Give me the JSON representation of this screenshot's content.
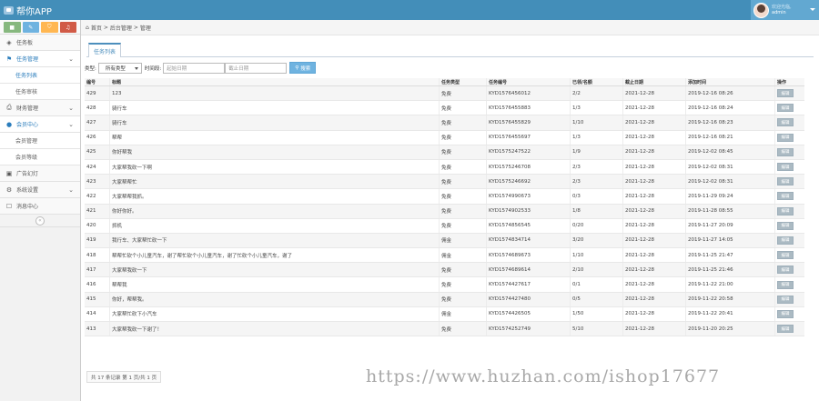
{
  "app": {
    "title": "帮你APP"
  },
  "user": {
    "greeting": "欢迎光临,",
    "name": "admin"
  },
  "quick_buttons": [
    "■",
    "✎",
    "⛉",
    "♫"
  ],
  "sidebar": {
    "items": [
      {
        "icon": "dashboard-icon",
        "glyph": "◈",
        "label": "任务板"
      },
      {
        "icon": "flag-icon",
        "glyph": "⚑",
        "label": "任务管理"
      },
      {
        "sub": true,
        "label": "任务列表"
      },
      {
        "sub": true,
        "label": "任务审核"
      },
      {
        "icon": "printer-icon",
        "glyph": "⎙",
        "label": "财务管理"
      },
      {
        "icon": "user-icon",
        "glyph": "●",
        "label": "会员中心"
      },
      {
        "sub": true,
        "label": "会员管理"
      },
      {
        "sub": true,
        "label": "会员等级"
      },
      {
        "icon": "picture-icon",
        "glyph": "▣",
        "label": "广告幻灯"
      },
      {
        "icon": "gear-icon",
        "glyph": "⚙",
        "label": "系统设置"
      },
      {
        "icon": "bookmark-icon",
        "glyph": "☐",
        "label": "消息中心"
      }
    ],
    "collapse_glyph": "«"
  },
  "breadcrumb": {
    "home": "首页",
    "level2": "后台管理",
    "current": "管理",
    "sep": ">"
  },
  "tabs": [
    {
      "label": "任务列表"
    }
  ],
  "filters": {
    "type_label": "类型:",
    "type_value": "所有类型",
    "time_label": "时间段:",
    "start_placeholder": "起始日期",
    "end_placeholder": "截止日期",
    "search_label": "搜索"
  },
  "table": {
    "headers": [
      "编号",
      "标题",
      "任务类型",
      "任务编号",
      "已领/名额",
      "截止日期",
      "添加时间",
      "操作"
    ],
    "action_label": "编辑",
    "rows": [
      [
        "429",
        "123",
        "免费",
        "KYD1576456012",
        "2/2",
        "2021-12-28",
        "2019-12-16 08:26"
      ],
      [
        "428",
        "骑行车",
        "免费",
        "KYD1576455883",
        "1/3",
        "2021-12-28",
        "2019-12-16 08:24"
      ],
      [
        "427",
        "骑行车",
        "免费",
        "KYD1576455829",
        "1/10",
        "2021-12-28",
        "2019-12-16 08:23"
      ],
      [
        "426",
        "帮帮",
        "免费",
        "KYD1576455697",
        "1/3",
        "2021-12-28",
        "2019-12-16 08:21"
      ],
      [
        "425",
        "你好帮我",
        "免费",
        "KYD1575247522",
        "1/9",
        "2021-12-28",
        "2019-12-02 08:45"
      ],
      [
        "424",
        "大家帮我砍一下啊",
        "免费",
        "KYD1575246708",
        "2/3",
        "2021-12-28",
        "2019-12-02 08:31"
      ],
      [
        "423",
        "大家帮帮忙",
        "免费",
        "KYD1575246692",
        "2/3",
        "2021-12-28",
        "2019-12-02 08:31"
      ],
      [
        "422",
        "大家帮帮我抓。",
        "免费",
        "KYD1574990673",
        "0/3",
        "2021-12-28",
        "2019-11-29 09:24"
      ],
      [
        "421",
        "你好你好。",
        "免费",
        "KYD1574902533",
        "1/8",
        "2021-12-28",
        "2019-11-28 08:55"
      ],
      [
        "420",
        "抓机",
        "免费",
        "KYD1574856545",
        "0/20",
        "2021-12-28",
        "2019-11-27 20:09"
      ],
      [
        "419",
        "我行车、大家帮忙砍一下",
        "佣金",
        "KYD1574834714",
        "3/20",
        "2021-12-28",
        "2019-11-27 14:05"
      ],
      [
        "418",
        "帮帮忙砍个小儿童汽车，谢了帮忙砍个小儿童汽车，谢了忙砍个小儿童汽车，谢了",
        "佣金",
        "KYD1574689673",
        "1/10",
        "2021-12-28",
        "2019-11-25 21:47"
      ],
      [
        "417",
        "大家帮我砍一下",
        "免费",
        "KYD1574689614",
        "2/10",
        "2021-12-28",
        "2019-11-25 21:46"
      ],
      [
        "416",
        "帮帮我",
        "免费",
        "KYD1574427617",
        "0/1",
        "2021-12-28",
        "2019-11-22 21:00"
      ],
      [
        "415",
        "你好，帮帮我。",
        "免费",
        "KYD1574427480",
        "0/5",
        "2021-12-28",
        "2019-11-22 20:58"
      ],
      [
        "414",
        "大家帮忙砍下小汽车",
        "佣金",
        "KYD1574426505",
        "1/50",
        "2021-12-28",
        "2019-11-22 20:41"
      ],
      [
        "413",
        "大家帮我砍一下谢了！",
        "免费",
        "KYD1574252749",
        "5/10",
        "2021-12-28",
        "2019-11-20 20:25"
      ]
    ]
  },
  "pager": {
    "text": "共 17 条记录 第 1 页/共 1 页"
  },
  "watermark": "https://www.huzhan.com/ishop17677"
}
